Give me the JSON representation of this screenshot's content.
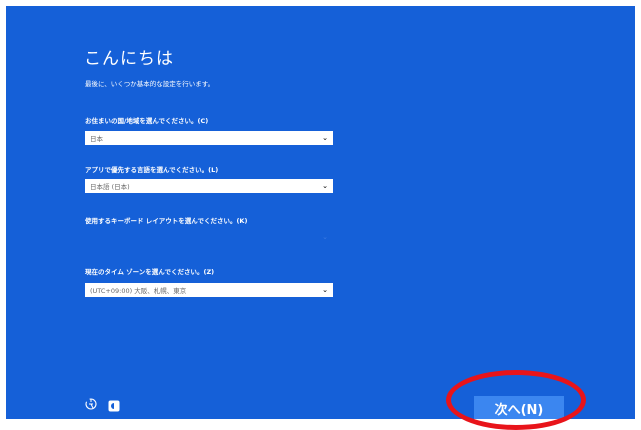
{
  "title": "こんにちは",
  "subtitle": "最後に、いくつか基本的な設定を行います。",
  "fields": [
    {
      "label": "お住まいの国/地域を選んでください。(C)",
      "value": "日本"
    },
    {
      "label": "アプリで優先する言語を選んでください。(L)",
      "value": "日本語 (日本)"
    },
    {
      "label": "使用するキーボード レイアウトを選んでください。(K)",
      "value": ""
    },
    {
      "label": "現在のタイム ゾーンを選んでください。(Z)",
      "value": "(UTC+09:00) 大阪、札幌、東京"
    }
  ],
  "next_button": "次へ(N)",
  "icons": {
    "accessibility": "accessibility-icon",
    "power": "power-icon",
    "dropdown": "chevron-down-icon"
  },
  "colors": {
    "background": "#1560d8",
    "button": "#3b86f0",
    "highlight_ring": "#e8141a"
  }
}
